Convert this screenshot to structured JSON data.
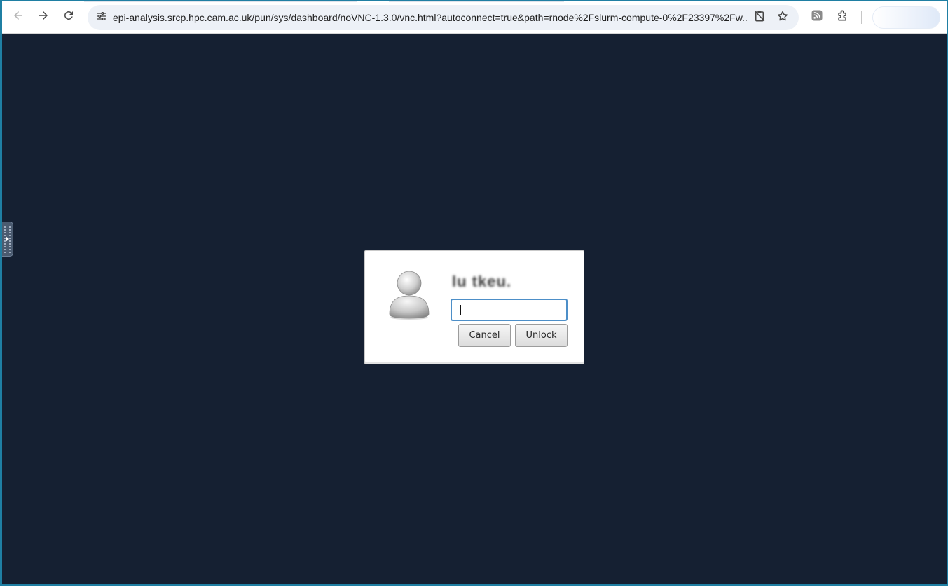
{
  "browser": {
    "url": "epi-analysis.srcp.hpc.cam.ac.uk/pun/sys/dashboard/noVNC-1.3.0/vnc.html?autoconnect=true&path=rnode%2Fslurm-compute-0%2F23397%2Fw...",
    "nav_icons": {
      "back": "back-arrow-icon",
      "forward": "forward-arrow-icon",
      "reload": "reload-icon",
      "site_info": "tune-icon",
      "clipboard": "clipboard-blocked-icon",
      "bookmark": "star-icon",
      "feed": "rss-feed-icon",
      "extensions": "puzzle-icon"
    }
  },
  "novnc": {
    "handle_icon": "expand-arrow-icon"
  },
  "unlock_dialog": {
    "user_name": "lu tkeu.",
    "password_value": "",
    "cancel_mnemonic": "C",
    "cancel_rest": "ancel",
    "unlock_mnemonic": "U",
    "unlock_rest": "nlock"
  },
  "colors": {
    "desktop_background": "#152032",
    "window_border": "#1f7fa3",
    "input_focus": "#4d8fc8"
  }
}
